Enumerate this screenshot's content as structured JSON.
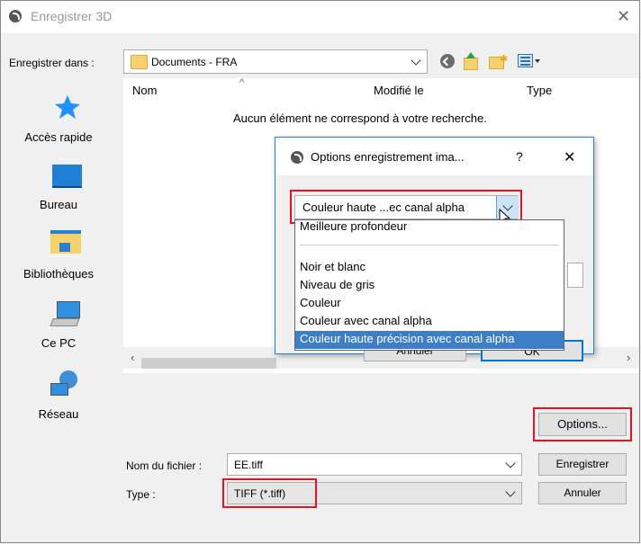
{
  "window": {
    "title": "Enregistrer 3D",
    "close_label": "✕"
  },
  "location": {
    "label": "Enregistrer dans :",
    "value": "Documents - FRA"
  },
  "sidebar": {
    "items": [
      {
        "label": "Accès rapide",
        "icon": "star-icon"
      },
      {
        "label": "Bureau",
        "icon": "desktop-icon"
      },
      {
        "label": "Bibliothèques",
        "icon": "libraries-icon"
      },
      {
        "label": "Ce PC",
        "icon": "computer-icon"
      },
      {
        "label": "Réseau",
        "icon": "network-icon"
      }
    ]
  },
  "file_list": {
    "columns": [
      "Nom",
      "Modifié le",
      "Type"
    ],
    "empty_message": "Aucun élément ne correspond à votre recherche."
  },
  "filename": {
    "label": "Nom du fichier :",
    "value": "EE.tiff"
  },
  "filetype": {
    "label": "Type :",
    "value": "TIFF (*.tiff)"
  },
  "buttons": {
    "options": "Options...",
    "save": "Enregistrer",
    "cancel": "Annuler"
  },
  "options_dialog": {
    "title": "Options enregistrement ima...",
    "help": "?",
    "close": "✕",
    "selected": "Couleur haute ...ec canal alpha",
    "cancel_label": "Annuler",
    "ok_label": "OK",
    "options_top": [
      "Meilleure profondeur"
    ],
    "options": [
      "Noir et blanc",
      "Niveau de gris",
      "Couleur",
      "Couleur avec canal alpha",
      "Couleur haute précision avec canal alpha"
    ],
    "highlighted_index": 4
  },
  "colors": {
    "highlight": "#3c7fc6",
    "red_annotation": "#e81123",
    "dialog_border": "#1883d7"
  }
}
